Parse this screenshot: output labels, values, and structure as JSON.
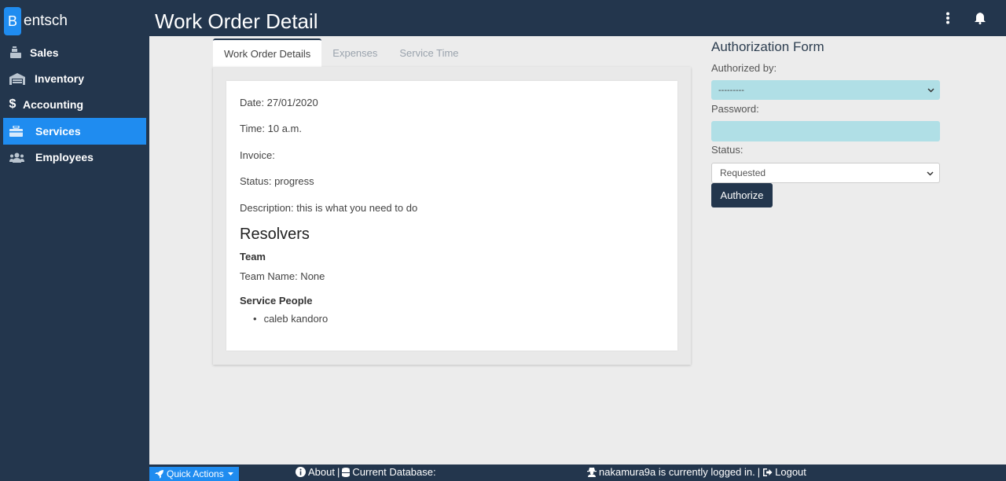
{
  "brand": {
    "letter": "B",
    "name": "entsch"
  },
  "sidebar": {
    "items": [
      {
        "label": "Sales",
        "icon": "cash-register-icon"
      },
      {
        "label": "Inventory",
        "icon": "warehouse-icon"
      },
      {
        "label": "Accounting",
        "icon": "dollar-icon",
        "glyph": "$"
      },
      {
        "label": "Services",
        "icon": "toolbox-icon",
        "active": true
      },
      {
        "label": "Employees",
        "icon": "users-icon"
      }
    ]
  },
  "header": {
    "title": "Work Order Detail"
  },
  "tabs": [
    {
      "label": "Work Order Details",
      "active": true
    },
    {
      "label": "Expenses"
    },
    {
      "label": "Service Time"
    }
  ],
  "details": {
    "date": "Date: 27/01/2020",
    "time": "Time: 10 a.m.",
    "invoice": "Invoice:",
    "status": "Status: progress",
    "description": "Description: this is what you need to do",
    "resolvers_heading": "Resolvers",
    "team_heading": "Team",
    "team_name": "Team Name: None",
    "service_people_heading": "Service People",
    "service_people": [
      "caleb kandoro"
    ]
  },
  "form": {
    "title": "Authorization Form",
    "authorized_by_label": "Authorized by:",
    "authorized_by_value": "---------",
    "password_label": "Password:",
    "status_label": "Status:",
    "status_value": "Requested",
    "submit_label": "Authorize",
    "field_color": "#b0dfe6"
  },
  "footer": {
    "quick_actions": "Quick Actions",
    "about": "About",
    "separator": "|",
    "current_database": "Current Database:",
    "logged_in": "nakamura9a is currently logged in.",
    "logout": "Logout"
  },
  "colors": {
    "navy": "#23364d",
    "accent": "#1f8cf0"
  }
}
